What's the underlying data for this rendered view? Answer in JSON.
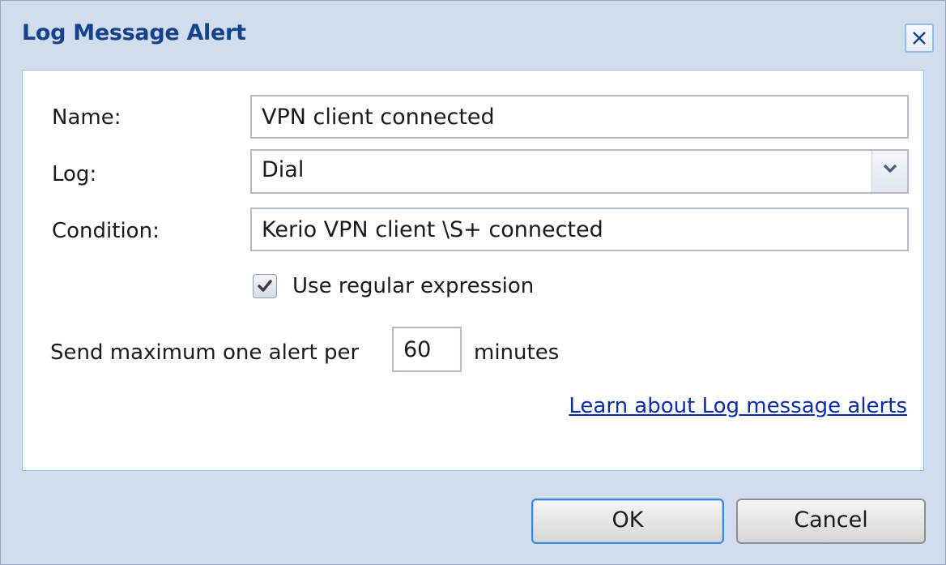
{
  "dialog": {
    "title": "Log Message Alert",
    "close_icon": "close-icon"
  },
  "form": {
    "name_label": "Name:",
    "name_value": "VPN client connected",
    "log_label": "Log:",
    "log_value": "Dial",
    "condition_label": "Condition:",
    "condition_value": "Kerio VPN client \\S+ connected",
    "regex_label": "Use regular expression",
    "regex_checked": true,
    "send_prefix": "Send maximum one alert per",
    "send_value": "60",
    "send_suffix": "minutes",
    "learn_link": "Learn about Log message alerts"
  },
  "buttons": {
    "ok_label": "OK",
    "cancel_label": "Cancel"
  },
  "colors": {
    "title": "#15428b",
    "dialog_bg": "#d1dcec",
    "link": "#0b2ea8",
    "ok_border": "#3f87d4"
  }
}
